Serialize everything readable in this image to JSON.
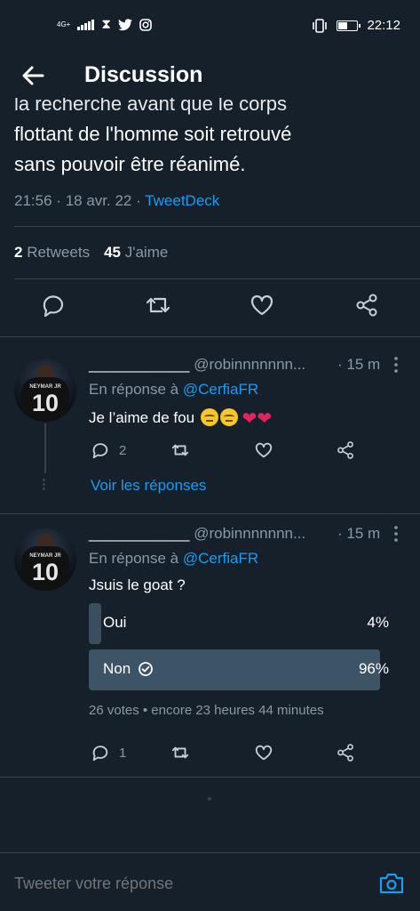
{
  "status_bar": {
    "network": "4G+",
    "time": "22:12"
  },
  "header": {
    "title": "Discussion"
  },
  "tweet": {
    "text_clipped": "la recherche avant que le corps",
    "text_line2": "flottant de l'homme soit retrouvé",
    "text_line3": "sans pouvoir être réanimé.",
    "time": "21:56",
    "date": "18 avr. 22",
    "separator": "·",
    "source": "TweetDeck",
    "retweets_count": "2",
    "retweets_label": "Retweets",
    "likes_count": "45",
    "likes_label": "J'aime"
  },
  "replies": [
    {
      "display_name": "____________",
      "handle": "@robinnnnnnn...",
      "time": "· 15 m",
      "reply_to_prefix": "En réponse à",
      "reply_to_handle": "@CerfiaFR",
      "avatar_name": "NEYMAR JR",
      "avatar_number": "10",
      "text": "Je l’aime de fou",
      "reply_count": "2",
      "see_replies": "Voir les réponses"
    },
    {
      "display_name": "____________",
      "handle": "@robinnnnnnn...",
      "time": "· 15 m",
      "reply_to_prefix": "En réponse à",
      "reply_to_handle": "@CerfiaFR",
      "avatar_name": "NEYMAR JR",
      "avatar_number": "10",
      "text": "Jsuis le goat ?",
      "reply_count": "1",
      "poll": {
        "options": [
          {
            "label": "Oui",
            "percent_text": "4%",
            "percent": 4
          },
          {
            "label": "Non",
            "percent_text": "96%",
            "percent": 96,
            "selected": true
          }
        ],
        "info": "26 votes • encore 23 heures 44 minutes"
      }
    }
  ],
  "compose": {
    "placeholder": "Tweeter votre réponse"
  },
  "colors": {
    "background": "#15202b",
    "accent": "#1d9bf0",
    "muted": "#8b98a5",
    "divider": "#38444d",
    "poll_fill": "#3d5466",
    "heart": "#e0245e"
  }
}
